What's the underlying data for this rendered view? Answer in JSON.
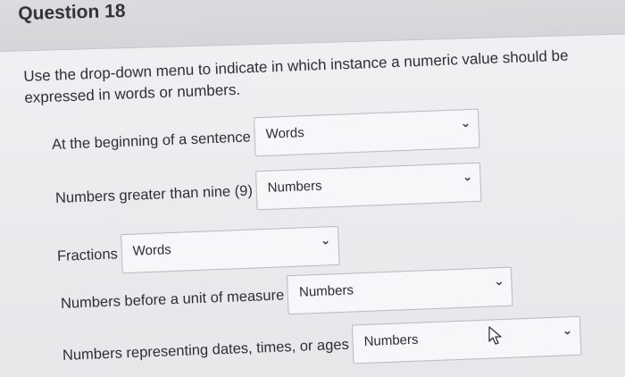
{
  "question": {
    "title": "Question 18",
    "instructions": "Use the drop-down menu to indicate in which instance a numeric value should be expressed in words or numbers."
  },
  "rows": [
    {
      "label": "At the beginning of a sentence",
      "selected": "Words",
      "icon": "chevron-down-icon"
    },
    {
      "label": "Numbers greater than nine (9)",
      "selected": "Numbers",
      "icon": "chevron-down-icon"
    },
    {
      "label": "Fractions",
      "selected": "Words",
      "icon": "chevron-down-icon"
    },
    {
      "label": "Numbers before a unit of measure",
      "selected": "Numbers",
      "icon": "chevron-down-icon"
    },
    {
      "label": "Numbers representing dates, times, or ages",
      "selected": "Numbers",
      "icon": "chevron-down-icon"
    }
  ],
  "cursor": {
    "icon": "mouse-pointer-icon"
  }
}
